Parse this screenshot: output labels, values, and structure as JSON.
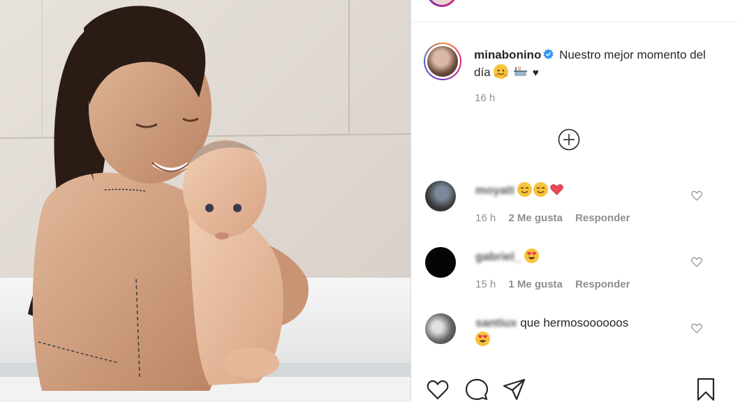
{
  "post": {
    "username": "minabonino",
    "caption_text": "Nuestro mejor momento del día",
    "time": "16 h"
  },
  "comments": [
    {
      "username": "moyatt",
      "text": "",
      "time": "16 h",
      "likes": "2 Me gusta",
      "reply": "Responder",
      "emojis": [
        "smiling-face-icon",
        "smiling-face-icon",
        "red-heart-icon"
      ]
    },
    {
      "username": "gabriel_",
      "text": "",
      "time": "15 h",
      "likes": "1 Me gusta",
      "reply": "Responder",
      "emojis": [
        "heart-eyes-icon"
      ]
    },
    {
      "username": "santiux",
      "text": "que hermosoooooos",
      "emojis": [
        "heart-eyes-icon"
      ]
    }
  ],
  "colors": {
    "meta_gray": "#8e8e8e",
    "text": "#262626",
    "verified_blue": "#3897f0",
    "heart_red": "#ed4956"
  }
}
